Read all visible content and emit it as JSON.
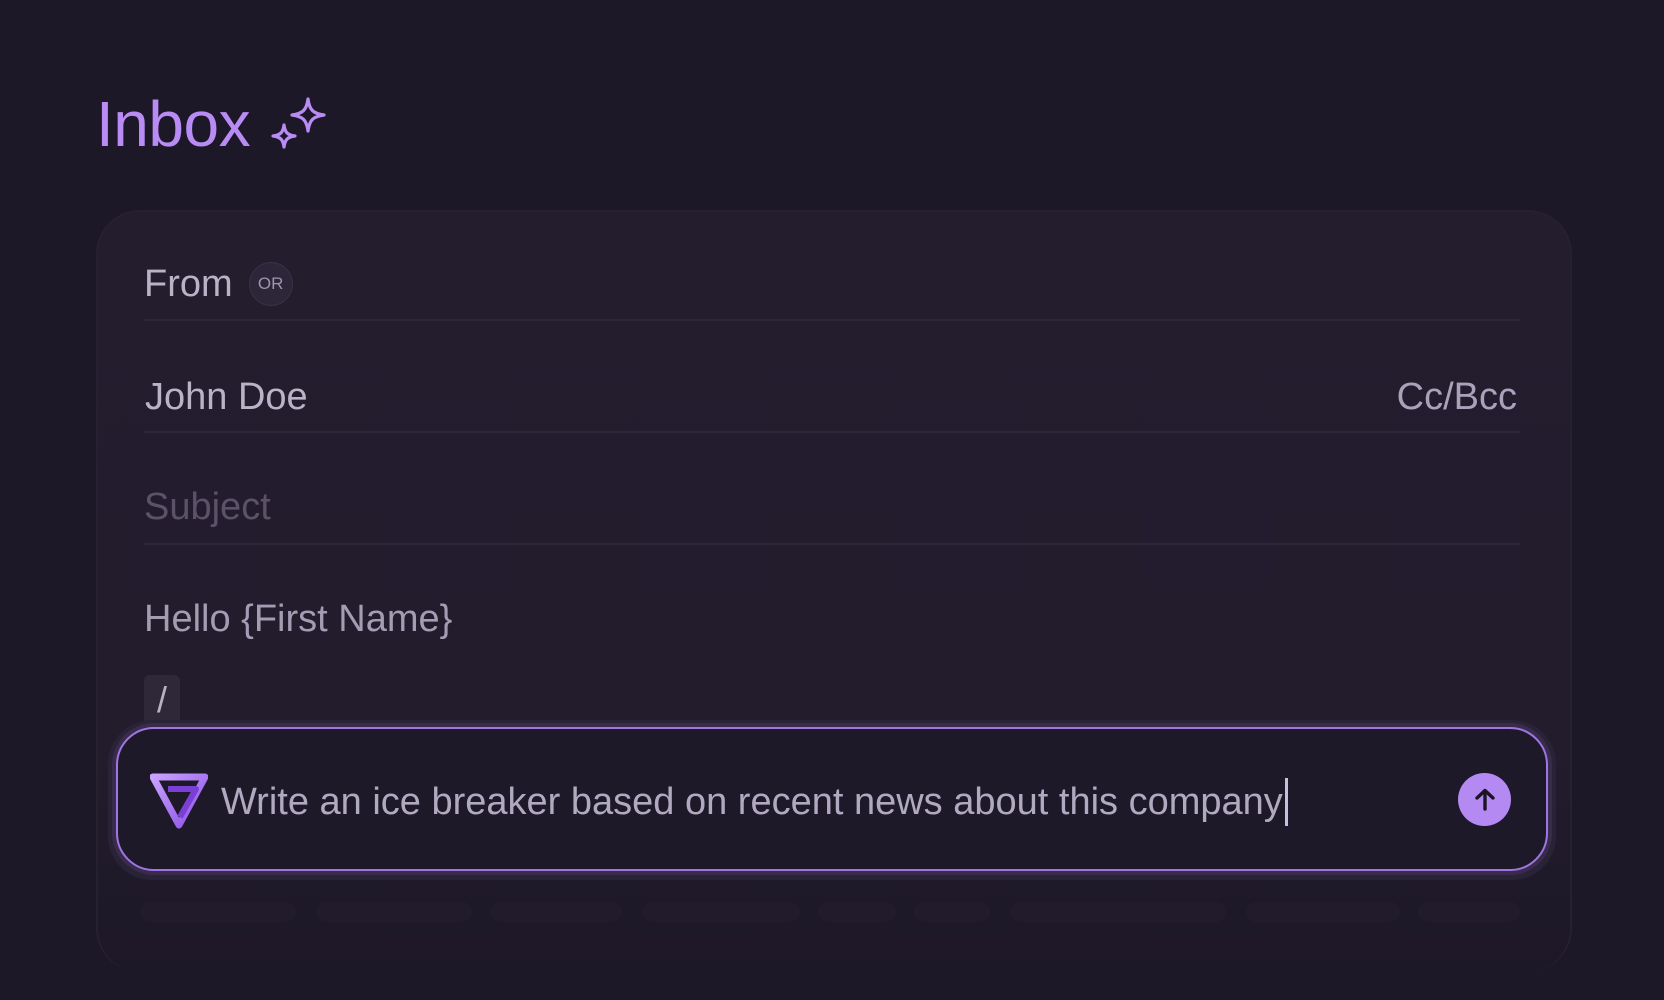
{
  "header": {
    "title": "Inbox",
    "title_icon": "sparkle-icon",
    "accent_color": "#b98cf5"
  },
  "compose": {
    "from_label": "From",
    "or_badge": "OR",
    "to_name": "John Doe",
    "cc_bcc_label": "Cc/Bcc",
    "subject_placeholder": "Subject",
    "body_greeting": "Hello {First Name}",
    "slash_command": "/"
  },
  "ai_prompt": {
    "logo_icon": "brand-logo-icon",
    "text": "Write an ice breaker based on recent news about this company",
    "send_icon": "arrow-up-icon",
    "border_color": "#9d76e3",
    "button_color": "#b48af2"
  }
}
